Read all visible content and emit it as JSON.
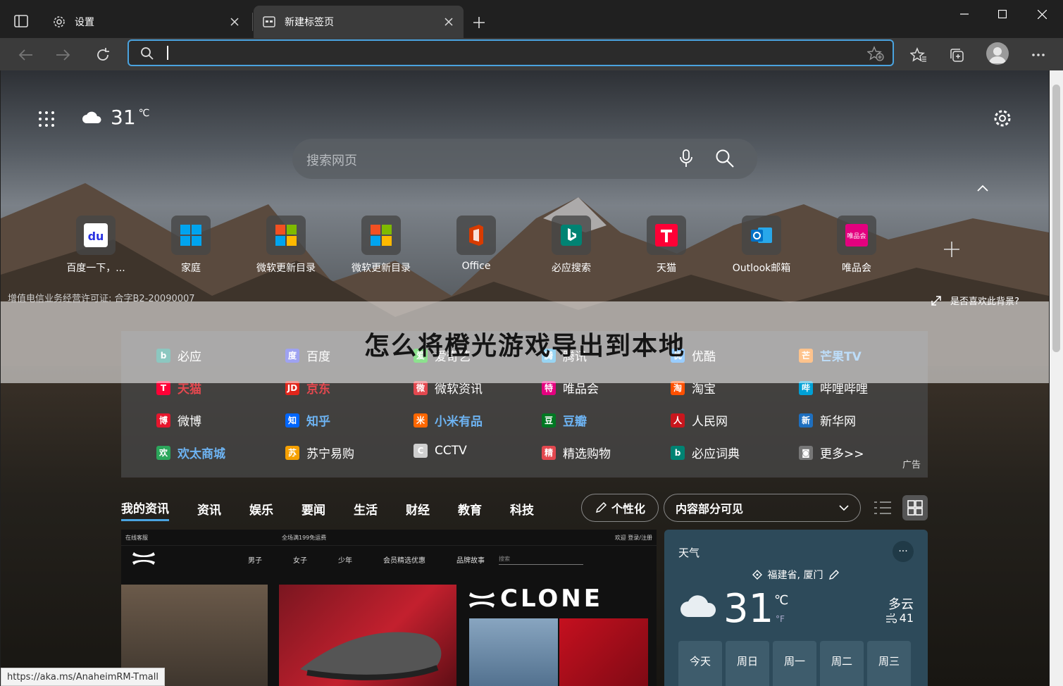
{
  "browser": {
    "tabs": [
      {
        "title": "设置",
        "icon": "gear-icon"
      },
      {
        "title": "新建标签页",
        "icon": "newtab-page-icon"
      }
    ],
    "address_value": ""
  },
  "page": {
    "weather_mini": {
      "temp": "31",
      "unit": "℃"
    },
    "search_placeholder": "搜索网页",
    "quicklinks": [
      {
        "label": "百度一下，...",
        "icon": "baidu-icon",
        "color": "#2932e1"
      },
      {
        "label": "家庭",
        "icon": "windows-icon",
        "color": "#0078d4"
      },
      {
        "label": "微软更新目录",
        "icon": "microsoft-icon",
        "color": "#f25022"
      },
      {
        "label": "微软更新目录",
        "icon": "microsoft-icon",
        "color": "#f25022"
      },
      {
        "label": "Office",
        "icon": "office-icon",
        "color": "#d83b01"
      },
      {
        "label": "必应搜索",
        "icon": "bing-icon",
        "color": "#008373"
      },
      {
        "label": "天猫",
        "icon": "tmall-icon",
        "color": "#ff0036"
      },
      {
        "label": "Outlook邮箱",
        "icon": "outlook-icon",
        "color": "#0072c6"
      },
      {
        "label": "唯品会",
        "icon": "vipshop-icon",
        "color": "#e4007f"
      }
    ],
    "license": "增值电信业务经营许可证: 合字B2-20090007",
    "bg_question": "是否喜欢此背景?",
    "overlay_title": "怎么将橙光游戏导出到本地",
    "links": [
      {
        "label": "必应",
        "style": "normal",
        "color": "#008373",
        "glyph": "b"
      },
      {
        "label": "百度",
        "style": "normal",
        "color": "#2932e1",
        "glyph": "度"
      },
      {
        "label": "爱奇艺",
        "style": "normal",
        "color": "#00be06",
        "glyph": "爱"
      },
      {
        "label": "腾讯",
        "style": "normal",
        "color": "#1ba1e2",
        "glyph": "腾"
      },
      {
        "label": "优酷",
        "style": "normal",
        "color": "#1e90ff",
        "glyph": "优"
      },
      {
        "label": "芒果TV",
        "style": "hl",
        "color": "#ff7a00",
        "glyph": "芒"
      },
      {
        "label": "天猫",
        "style": "hr",
        "color": "#ff0036",
        "glyph": "T"
      },
      {
        "label": "京东",
        "style": "hr",
        "color": "#e1251b",
        "glyph": "JD"
      },
      {
        "label": "微软资讯",
        "style": "normal",
        "color": "#e3484f",
        "glyph": "微"
      },
      {
        "label": "唯品会",
        "style": "normal",
        "color": "#e4007f",
        "glyph": "特"
      },
      {
        "label": "淘宝",
        "style": "normal",
        "color": "#ff5000",
        "glyph": "淘"
      },
      {
        "label": "哔哩哔哩",
        "style": "normal",
        "color": "#00a1d6",
        "glyph": "哔"
      },
      {
        "label": "微博",
        "style": "normal",
        "color": "#e6162d",
        "glyph": "博"
      },
      {
        "label": "知乎",
        "style": "hl",
        "color": "#0066ff",
        "glyph": "知"
      },
      {
        "label": "小米有品",
        "style": "hl",
        "color": "#ff6700",
        "glyph": "米"
      },
      {
        "label": "豆瓣",
        "style": "hl",
        "color": "#007722",
        "glyph": "豆"
      },
      {
        "label": "人民网",
        "style": "normal",
        "color": "#c8161d",
        "glyph": "人"
      },
      {
        "label": "新华网",
        "style": "normal",
        "color": "#1e6fbf",
        "glyph": "新"
      },
      {
        "label": "欢太商城",
        "style": "hl",
        "color": "#2ca65b",
        "glyph": "欢"
      },
      {
        "label": "苏宁易购",
        "style": "normal",
        "color": "#f6a000",
        "glyph": "苏"
      },
      {
        "label": "CCTV",
        "style": "normal",
        "color": "#cfcfcf",
        "glyph": "C"
      },
      {
        "label": "精选购物",
        "style": "normal",
        "color": "#e3484f",
        "glyph": "精"
      },
      {
        "label": "必应词典",
        "style": "normal",
        "color": "#008373",
        "glyph": "b"
      },
      {
        "label": "更多>>",
        "style": "normal",
        "color": "#777777",
        "glyph": "◙"
      }
    ],
    "ad_label": "广告",
    "news_tabs": [
      "我的资讯",
      "资讯",
      "娱乐",
      "要闻",
      "生活",
      "财经",
      "教育",
      "科技"
    ],
    "personalize": "个性化",
    "content_visibility": "内容部分可见",
    "adcard": {
      "strip_left": "在线客服",
      "strip_mid": "全场满199免运费",
      "strip_right": "欢迎 登录/注册",
      "menu": [
        "男子",
        "女子",
        "少年",
        "会员精选优惠",
        "品牌故事"
      ],
      "search_ph": "搜索",
      "clone_text": "CLONE"
    },
    "status_url": "https://aka.ms/AnaheimRM-Tmall",
    "weather": {
      "title": "天气",
      "location": "福建省, 厦门",
      "temp": "31",
      "c": "℃",
      "f": "°F",
      "condition": "多云",
      "aqi": "41",
      "days": [
        "今天",
        "周日",
        "周一",
        "周二",
        "周三"
      ]
    }
  }
}
